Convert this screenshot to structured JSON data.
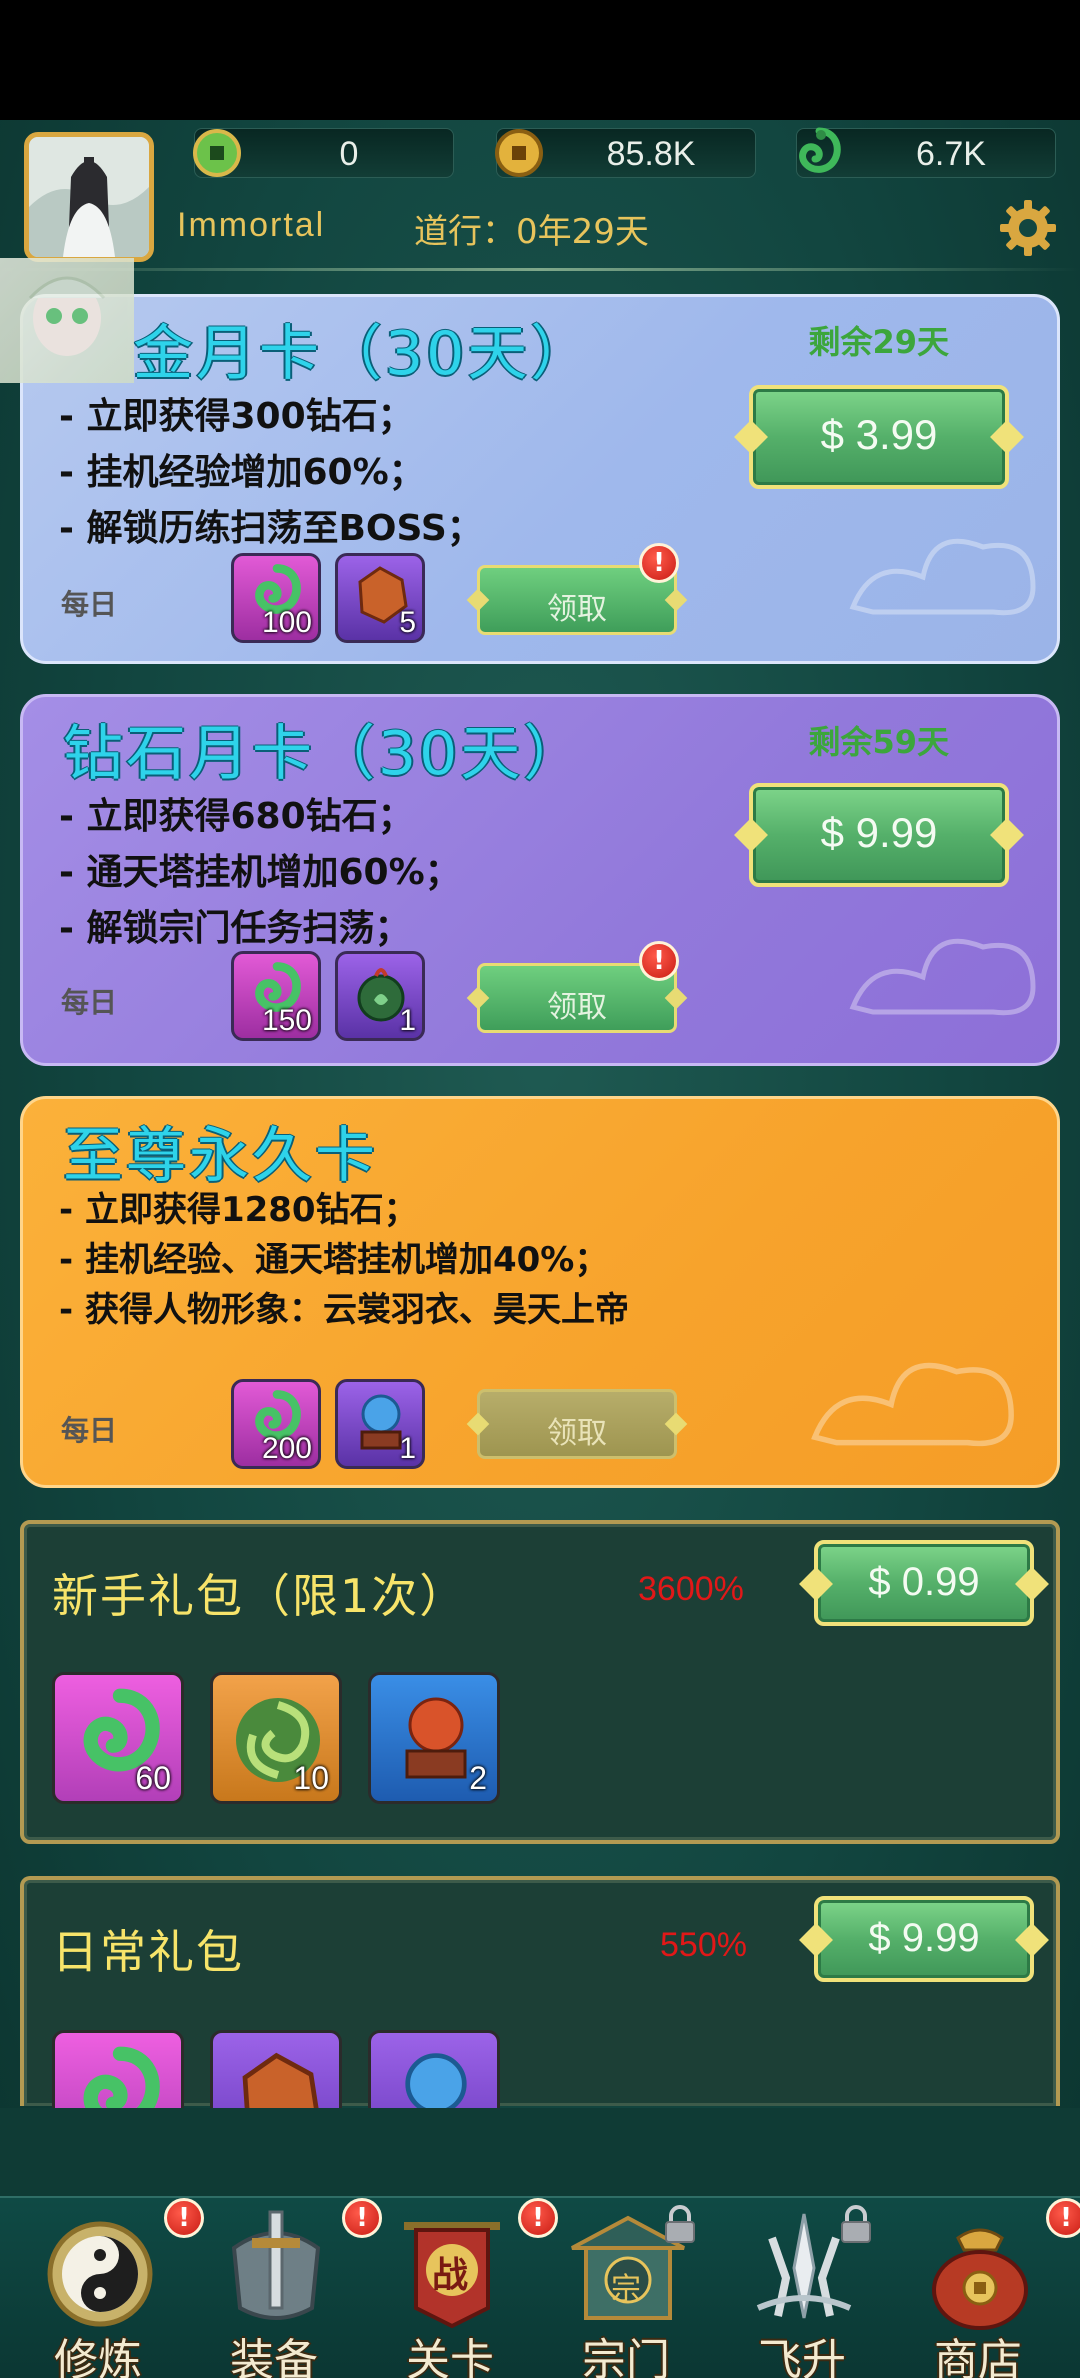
{
  "currencies": {
    "jade_coin": "0",
    "gold_coin": "85.8K",
    "dragon_jade": "6.7K"
  },
  "player": {
    "name": "Immortal",
    "dao_label": "道行：0年29天"
  },
  "gold_card": {
    "title": "金月卡（30天）",
    "remaining": "剩余29天",
    "lines": [
      "- 立即获得300钻石；",
      "- 挂机经验增加60%；",
      "- 解锁历练扫荡至BOSS；"
    ],
    "price": "$ 3.99",
    "daily_label": "每日",
    "items": [
      {
        "icon": "dragon-jade-icon",
        "count": "100"
      },
      {
        "icon": "ore-icon",
        "count": "5"
      }
    ],
    "claim_label": "领取",
    "alert": "!"
  },
  "diamond_card": {
    "title": "钻石月卡（30天）",
    "remaining": "剩余59天",
    "lines": [
      "- 立即获得680钻石；",
      "- 通天塔挂机增加60%；",
      "- 解锁宗门任务扫荡；"
    ],
    "price": "$ 9.99",
    "daily_label": "每日",
    "items": [
      {
        "icon": "dragon-jade-icon",
        "count": "150"
      },
      {
        "icon": "pouch-icon",
        "count": "1"
      }
    ],
    "claim_label": "领取",
    "alert": "!"
  },
  "supreme_card": {
    "title": "至尊永久卡",
    "lines": [
      "- 立即获得1280钻石；",
      "- 挂机经验、通天塔挂机增加40%；",
      "- 获得人物形象：云裳羽衣、昊天上帝"
    ],
    "daily_label": "每日",
    "items": [
      {
        "icon": "dragon-jade-icon",
        "count": "200"
      },
      {
        "icon": "orb-pedestal-icon",
        "count": "1"
      }
    ],
    "claim_label": "领取"
  },
  "newbie_pack": {
    "title": "新手礼包（限1次）",
    "percent": "3600%",
    "price": "$ 0.99",
    "items": [
      {
        "icon": "dragon-jade-icon",
        "count": "60"
      },
      {
        "icon": "swirl-icon",
        "count": "10"
      },
      {
        "icon": "orb-pedestal-icon",
        "count": "2"
      }
    ]
  },
  "daily_pack": {
    "title": "日常礼包",
    "percent": "550%",
    "price": "$ 9.99",
    "items": [
      {
        "icon": "dragon-jade-icon"
      },
      {
        "icon": "ore-icon"
      },
      {
        "icon": "orb-pedestal-icon"
      }
    ]
  },
  "nav": {
    "items": [
      {
        "label": "修炼",
        "icon": "yin-yang-icon",
        "alert": "!"
      },
      {
        "label": "装备",
        "icon": "sword-icon",
        "alert": "!"
      },
      {
        "label": "关卡",
        "icon": "battle-banner-icon",
        "alert": "!",
        "badge": "战"
      },
      {
        "label": "宗门",
        "icon": "sect-gate-icon",
        "locked": true,
        "badge": "宗"
      },
      {
        "label": "飞升",
        "icon": "ascend-icon",
        "locked": true
      },
      {
        "label": "商店",
        "icon": "shop-bag-icon",
        "alert": "!"
      }
    ]
  },
  "colors": {
    "accent_gold": "#e7c45c",
    "title_cyan": "#2ed3ea",
    "remain_green": "#3ca63c",
    "percent_red": "#e11818"
  }
}
